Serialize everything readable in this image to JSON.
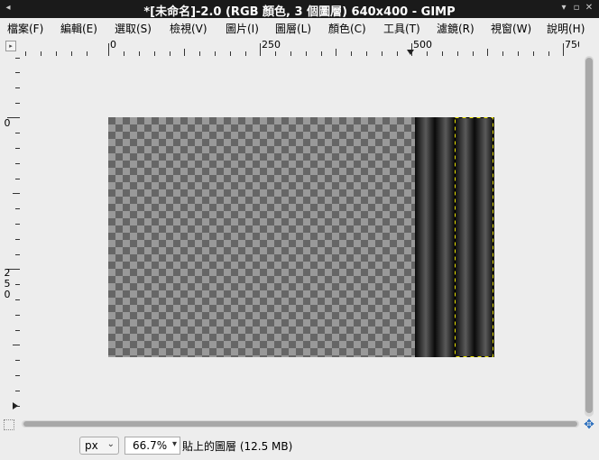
{
  "window": {
    "title": "*[未命名]-2.0 (RGB 顏色, 3 個圖層) 640x400 - GIMP"
  },
  "menu": [
    {
      "name": "menu-file",
      "label": "檔案(F)"
    },
    {
      "name": "menu-edit",
      "label": "編輯(E)"
    },
    {
      "name": "menu-select",
      "label": "選取(S)"
    },
    {
      "name": "menu-view",
      "label": "檢視(V)"
    },
    {
      "name": "menu-image",
      "label": "圖片(I)"
    },
    {
      "name": "menu-layer",
      "label": "圖層(L)"
    },
    {
      "name": "menu-colors",
      "label": "顏色(C)"
    },
    {
      "name": "menu-tools",
      "label": "工具(T)"
    },
    {
      "name": "menu-filters",
      "label": "濾鏡(R)"
    },
    {
      "name": "menu-windows",
      "label": "視窗(W)"
    },
    {
      "name": "menu-help",
      "label": "說明(H)"
    }
  ],
  "hruler": {
    "labels": [
      "0",
      "250",
      "500",
      "750"
    ]
  },
  "vruler": {
    "labels": [
      "0",
      "2",
      "5",
      "0"
    ]
  },
  "status": {
    "unit": "px",
    "zoom": "66.7%",
    "message": "貼上的圖層 (12.5 MB)"
  },
  "icons": {
    "ruler_corner": "menu-arrow-icon",
    "quick_mask": "quick-mask-icon",
    "navigate": "navigate-icon",
    "title_menu": "window-menu-icon",
    "minimize": "minimize-icon",
    "maximize": "maximize-icon",
    "close": "close-icon"
  }
}
